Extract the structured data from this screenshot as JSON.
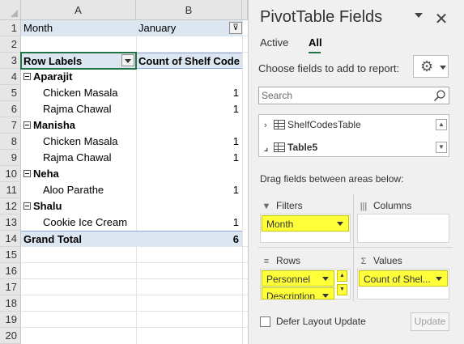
{
  "sheet": {
    "columns": [
      "A",
      "B"
    ],
    "row_numbers": [
      "1",
      "2",
      "3",
      "4",
      "5",
      "6",
      "7",
      "8",
      "9",
      "10",
      "11",
      "12",
      "13",
      "14",
      "15",
      "16",
      "17",
      "18",
      "19",
      "20"
    ],
    "filter_row": {
      "field": "Month",
      "value": "January"
    },
    "header": {
      "row_labels": "Row Labels",
      "value_header": "Count of Shelf Code"
    },
    "rows": [
      {
        "label": "Aparajit",
        "value": "",
        "level": 0
      },
      {
        "label": "Chicken Masala",
        "value": "1",
        "level": 1
      },
      {
        "label": "Rajma Chawal",
        "value": "1",
        "level": 1
      },
      {
        "label": "Manisha",
        "value": "",
        "level": 0
      },
      {
        "label": "Chicken Masala",
        "value": "1",
        "level": 1
      },
      {
        "label": "Rajma Chawal",
        "value": "1",
        "level": 1
      },
      {
        "label": "Neha",
        "value": "",
        "level": 0
      },
      {
        "label": "Aloo Parathe",
        "value": "1",
        "level": 1
      },
      {
        "label": "Shalu",
        "value": "",
        "level": 0
      },
      {
        "label": "Cookie Ice Cream",
        "value": "1",
        "level": 1
      }
    ],
    "grand_total": {
      "label": "Grand Total",
      "value": "6"
    }
  },
  "pane": {
    "title": "PivotTable Fields",
    "close_glyph": "✕",
    "tabs": [
      {
        "label": "Active"
      },
      {
        "label": "All"
      }
    ],
    "choose_label": "Choose fields to add to report:",
    "gear_glyph": "⚙",
    "search": {
      "placeholder": "Search"
    },
    "field_tables": [
      {
        "label": "ShelfCodesTable",
        "glyph": "›"
      },
      {
        "label": "Table5",
        "glyph": "⌟"
      }
    ],
    "drag_label": "Drag fields between areas below:",
    "areas": {
      "filters": {
        "title": "Filters",
        "icon": "▼",
        "chips": [
          "Month"
        ]
      },
      "columns": {
        "title": "Columns",
        "icon": "|||",
        "chips": []
      },
      "rows": {
        "title": "Rows",
        "icon": "≡",
        "chips": [
          "Personnel",
          "Description"
        ]
      },
      "values": {
        "title": "Values",
        "icon": "Σ",
        "chips": [
          "Count of Shel..."
        ]
      }
    },
    "defer_label": "Defer Layout Update",
    "update_label": "Update"
  },
  "colors": {
    "pivot_fill": "#dce6f1",
    "chip_highlight": "#ffff3a",
    "active_cell_border": "#217346"
  }
}
